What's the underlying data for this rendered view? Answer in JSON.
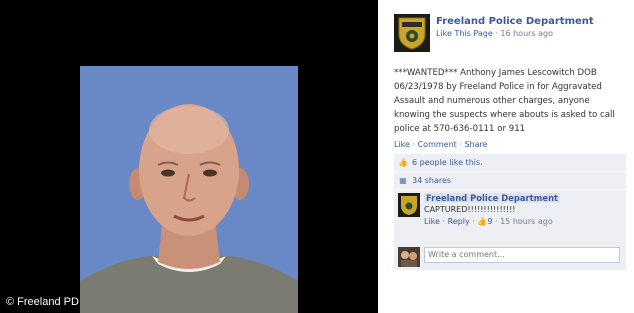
{
  "photo": {
    "credit": "© Freeland PD"
  },
  "post": {
    "page_name": "Freeland Police Department",
    "like_page": "Like This Page",
    "timestamp": "16 hours ago",
    "text": "***WANTED*** Anthony James Lescowitch DOB 06/23/1978 by Freeland Police in for Aggravated Assault and numerous other charges, anyone knowing the suspects where abouts is asked to call police at 570-636-0111 or 911",
    "actions": {
      "like": "Like",
      "comment": "Comment",
      "share": "Share"
    },
    "likes_text": "6 people like this.",
    "shares_text": "34 shares"
  },
  "comment": {
    "author": "Freeland Police Department",
    "text": "CAPTURED!!!!!!!!!!!!!!!",
    "like": "Like",
    "reply": "Reply",
    "like_count": "9",
    "timestamp": "15 hours ago"
  },
  "write_comment": {
    "placeholder": "Write a comment..."
  },
  "colors": {
    "link": "#3b5998",
    "box_bg": "#edeff4",
    "mugshot_bg": "#6f8fc8"
  }
}
